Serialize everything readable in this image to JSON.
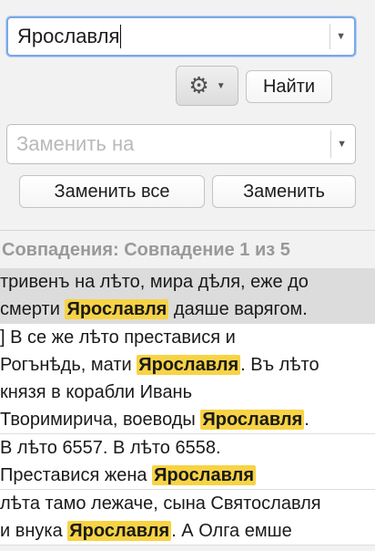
{
  "find": {
    "value": "Ярославля",
    "dropdown_icon": "chevron-down-icon"
  },
  "options": {
    "icon": "gear-icon"
  },
  "find_button": "Найти",
  "replace": {
    "value": "",
    "placeholder": "Заменить на",
    "dropdown_icon": "chevron-down-icon"
  },
  "replace_all_button": "Заменить все",
  "replace_button": "Заменить",
  "matches_header": "Совпадения: Совпадение 1 из 5",
  "colors": {
    "highlight": "#f7d345",
    "selected_row": "#dcdcdc"
  },
  "results": [
    {
      "lines": [
        {
          "before": "тривенъ на лѣто, мира дѣля, еже до",
          "match": "",
          "after": ""
        },
        {
          "before": "смерти ",
          "match": "Ярославля",
          "after": " даяше варягом."
        }
      ]
    },
    {
      "lines": [
        {
          "before": "] В се же лѣто преставися и",
          "match": "",
          "after": ""
        },
        {
          "before": "Рогънѣдь, мати ",
          "match": "Ярославля",
          "after": ".  Въ лѣто"
        },
        {
          "before": "князя в корабли Ивань",
          "match": "",
          "after": ""
        },
        {
          "before": "Творимирича, воеводы ",
          "match": "Ярославля",
          "after": "."
        }
      ]
    },
    {
      "lines": [
        {
          "before": " В лѣто 6557.  В лѣто 6558.",
          "match": "",
          "after": ""
        },
        {
          "before": "Преставися жена ",
          "match": "Ярославля",
          "after": ""
        }
      ]
    },
    {
      "lines": [
        {
          "before": "лѣта тамо лежаче, сына Святославля",
          "match": "",
          "after": ""
        },
        {
          "before": "и внука ",
          "match": "Ярославля",
          "after": ". А Олга емше"
        }
      ]
    }
  ]
}
